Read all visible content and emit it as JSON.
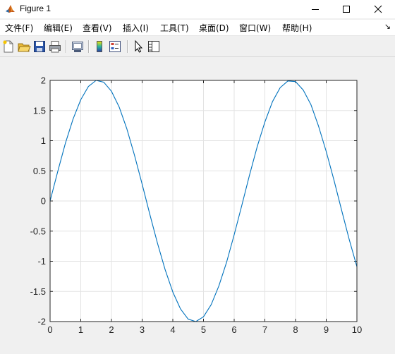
{
  "window": {
    "title": "Figure 1",
    "minimize_icon": "minimize-icon",
    "maximize_icon": "maximize-icon",
    "close_icon": "close-icon"
  },
  "menu": {
    "items": [
      {
        "label": "文件(F)"
      },
      {
        "label": "编辑(E)"
      },
      {
        "label": "查看(V)"
      },
      {
        "label": "插入(I)"
      },
      {
        "label": "工具(T)"
      },
      {
        "label": "桌面(D)"
      },
      {
        "label": "窗口(W)"
      },
      {
        "label": "帮助(H)"
      }
    ],
    "overflow_arrow": "↘"
  },
  "toolbar": {
    "buttons": [
      {
        "icon": "new-figure-icon"
      },
      {
        "icon": "open-file-icon"
      },
      {
        "icon": "save-icon"
      },
      {
        "icon": "print-icon"
      },
      {
        "icon": "link-plot-icon"
      },
      {
        "icon": "insert-colorbar-icon"
      },
      {
        "icon": "insert-legend-icon"
      },
      {
        "icon": "edit-plot-icon"
      },
      {
        "icon": "property-inspector-icon"
      }
    ]
  },
  "chart_data": {
    "type": "line",
    "title": "",
    "xlabel": "",
    "ylabel": "",
    "xlim": [
      0,
      10
    ],
    "ylim": [
      -2,
      2
    ],
    "xticks": [
      "0",
      "1",
      "2",
      "3",
      "4",
      "5",
      "6",
      "7",
      "8",
      "9",
      "10"
    ],
    "yticks": [
      "2",
      "1.5",
      "1",
      "0.5",
      "0",
      "-0.5",
      "-1",
      "-1.5",
      "-2"
    ],
    "grid": true,
    "line_color": "#0072bd",
    "series": [
      {
        "x": [
          0,
          0.25,
          0.5,
          0.75,
          1,
          1.25,
          1.5,
          1.75,
          2,
          2.25,
          2.5,
          2.75,
          3,
          3.25,
          3.5,
          3.75,
          4,
          4.25,
          4.5,
          4.75,
          5,
          5.25,
          5.5,
          5.75,
          6,
          6.25,
          6.5,
          6.75,
          7,
          7.25,
          7.5,
          7.75,
          8,
          8.25,
          8.5,
          8.75,
          9,
          9.25,
          9.5,
          9.75,
          10
        ],
        "y": [
          0,
          0.49,
          0.96,
          1.36,
          1.68,
          1.9,
          2.0,
          1.97,
          1.82,
          1.56,
          1.2,
          0.76,
          0.28,
          -0.22,
          -0.7,
          -1.14,
          -1.51,
          -1.79,
          -1.96,
          -2.0,
          -1.92,
          -1.72,
          -1.41,
          -1.02,
          -0.56,
          -0.07,
          0.43,
          0.9,
          1.31,
          1.65,
          1.88,
          1.99,
          1.98,
          1.84,
          1.6,
          1.24,
          0.82,
          0.35,
          -0.15,
          -0.64,
          -1.09
        ]
      }
    ]
  }
}
